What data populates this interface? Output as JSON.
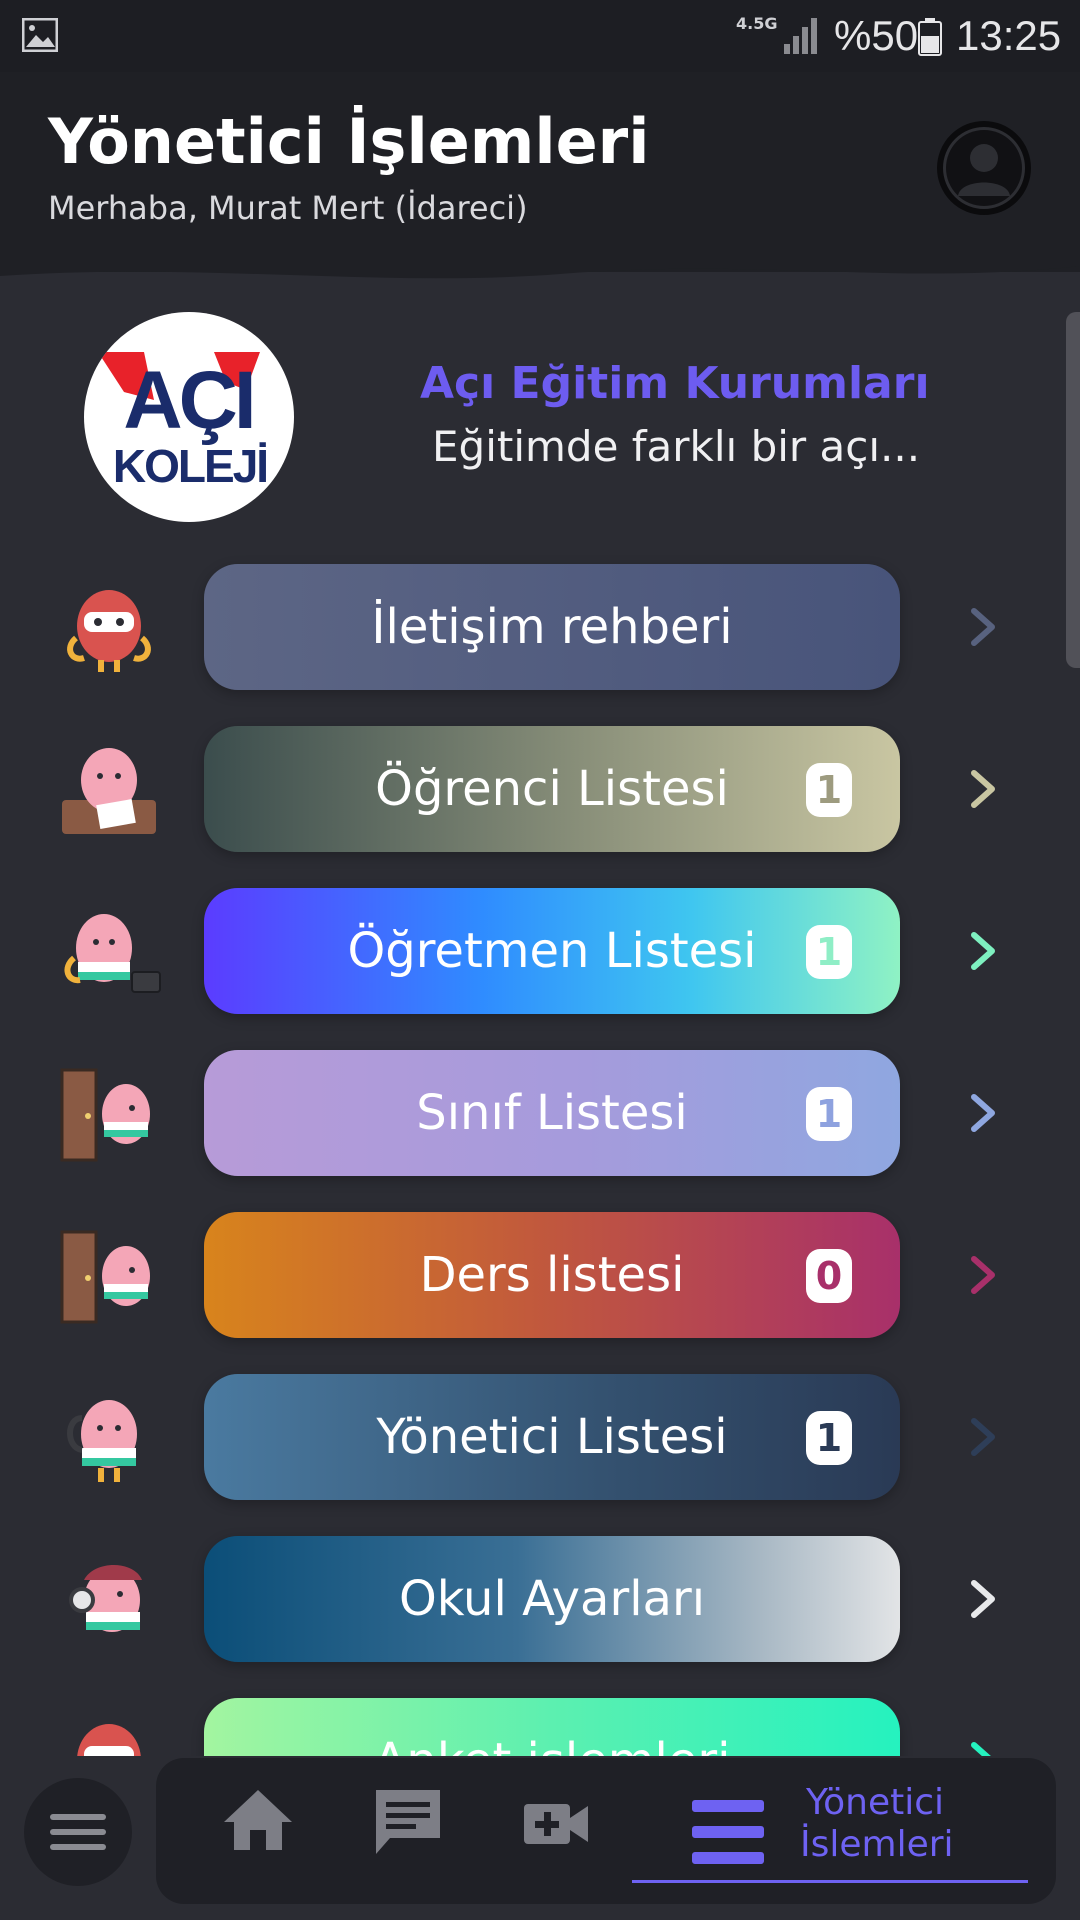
{
  "status_bar": {
    "network": "4.5G",
    "battery": "%50",
    "time": "13:25"
  },
  "header": {
    "title": "Yönetici İşlemleri",
    "greeting": "Merhaba, Murat Mert (İdareci)"
  },
  "brand": {
    "logo_text_top": "AÇI",
    "logo_text_bottom": "KOLEJİ",
    "name": "Açı Eğitim Kurumları",
    "tagline": "Eğitimde farklı bir açı..."
  },
  "menu": [
    {
      "label": "İletişim rehberi",
      "badge": null
    },
    {
      "label": "Öğrenci Listesi",
      "badge": "1"
    },
    {
      "label": "Öğretmen Listesi",
      "badge": "1"
    },
    {
      "label": "Sınıf Listesi",
      "badge": "1"
    },
    {
      "label": "Ders listesi",
      "badge": "0"
    },
    {
      "label": "Yönetici Listesi",
      "badge": "1"
    },
    {
      "label": "Okul Ayarları",
      "badge": null
    },
    {
      "label": "Anket işlemleri",
      "badge": null
    }
  ],
  "bottom_nav": {
    "active_label_line1": "Yönetici",
    "active_label_line2": "İslemleri",
    "items": [
      "home-icon",
      "chat-icon",
      "video-add-icon",
      "menu-icon"
    ]
  },
  "colors": {
    "accent": "#6e62f2",
    "background": "#2b2c33",
    "header": "#1f2025"
  }
}
